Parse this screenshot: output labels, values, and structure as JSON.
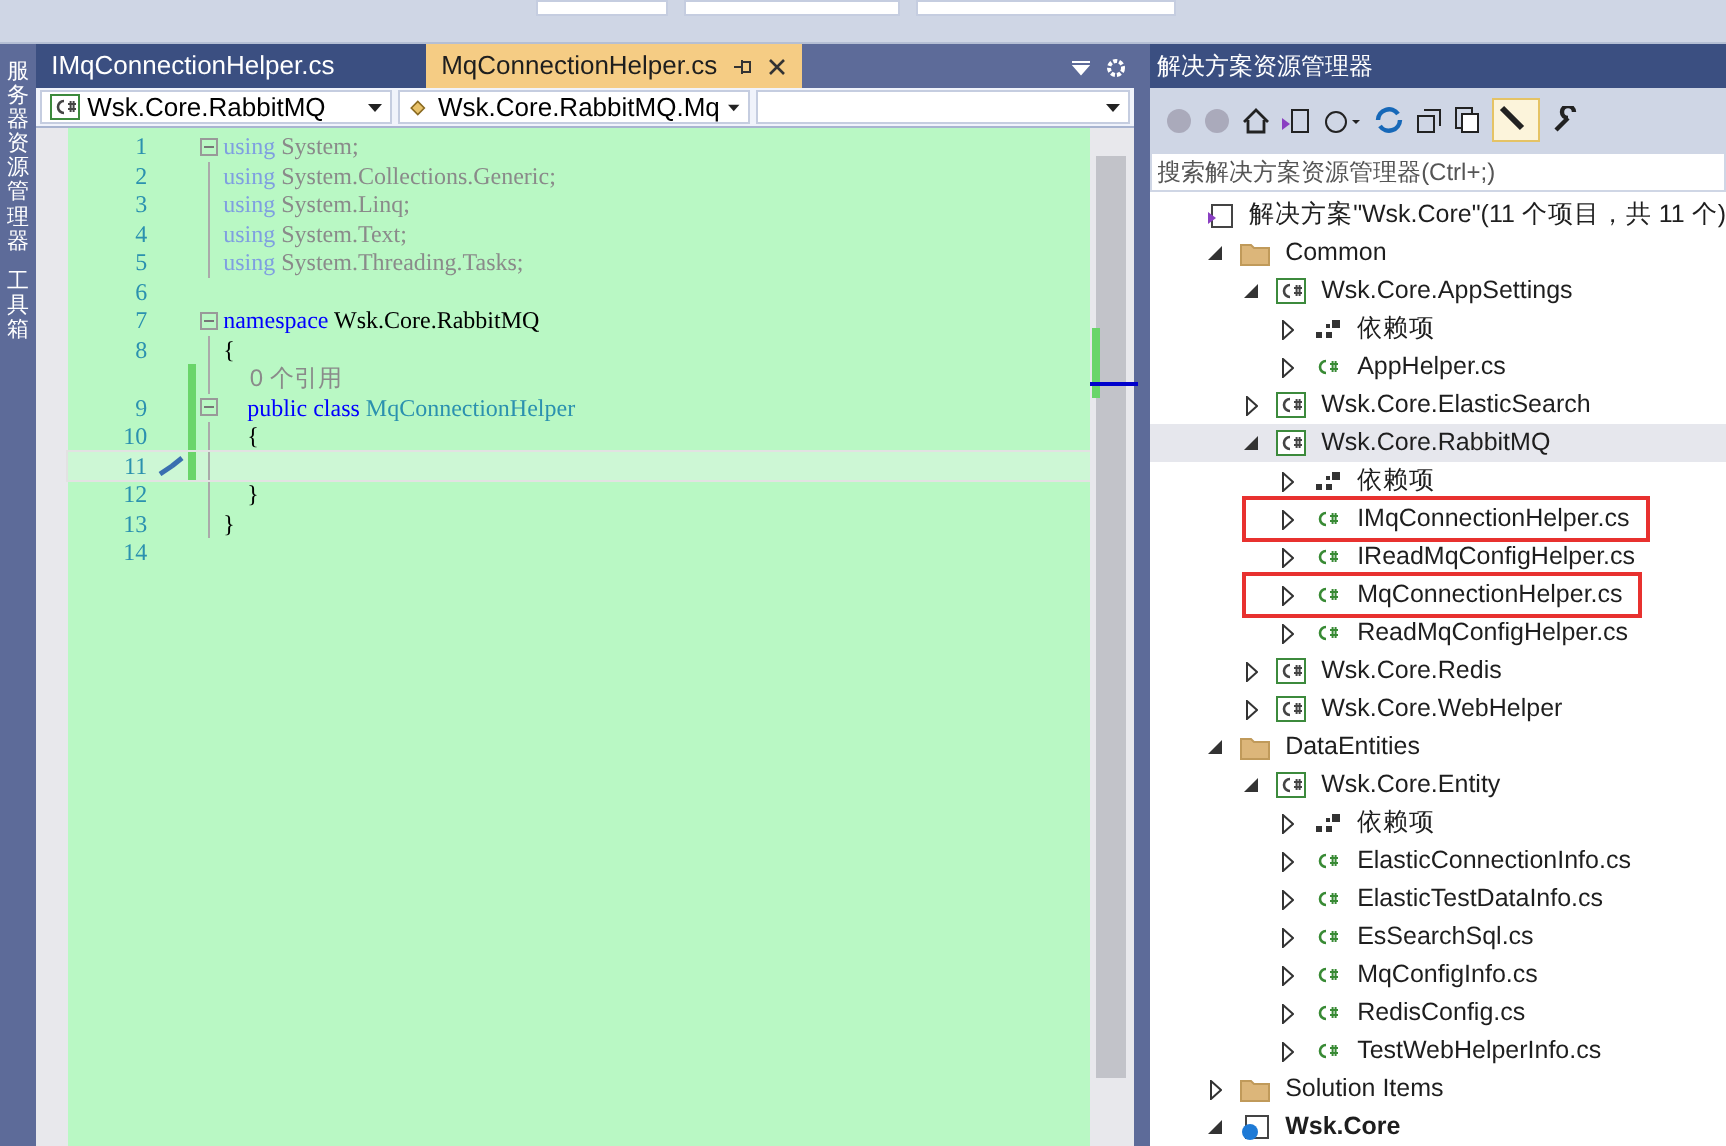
{
  "side_tabs": [
    "服务器资源管理器",
    "工具箱"
  ],
  "editor_tabs": [
    {
      "label": "IMqConnectionHelper.cs",
      "selected": false
    },
    {
      "label": "MqConnectionHelper.cs",
      "selected": true
    }
  ],
  "nav_bar": {
    "project": "Wsk.Core.RabbitMQ",
    "type": "Wsk.Core.RabbitMQ.Mq"
  },
  "code_lines": [
    {
      "number": "1",
      "kind": "fold",
      "changed": false,
      "current": false,
      "segments": [
        {
          "text": "using",
          "kind": "dimkeyword"
        },
        {
          "text": " System;",
          "kind": "dim"
        }
      ]
    },
    {
      "number": "2",
      "kind": "body",
      "changed": false,
      "current": false,
      "segments": [
        {
          "text": "using",
          "kind": "dimkeyword"
        },
        {
          "text": " System.Collections.Generic;",
          "kind": "dim"
        }
      ]
    },
    {
      "number": "3",
      "kind": "body",
      "changed": false,
      "current": false,
      "segments": [
        {
          "text": "using",
          "kind": "dimkeyword"
        },
        {
          "text": " System.Linq;",
          "kind": "dim"
        }
      ]
    },
    {
      "number": "4",
      "kind": "body",
      "changed": false,
      "current": false,
      "segments": [
        {
          "text": "using",
          "kind": "dimkeyword"
        },
        {
          "text": " System.Text;",
          "kind": "dim"
        }
      ]
    },
    {
      "number": "5",
      "kind": "body",
      "changed": false,
      "current": false,
      "segments": [
        {
          "text": "using",
          "kind": "dimkeyword"
        },
        {
          "text": " System.Threading.Tasks;",
          "kind": "dim"
        }
      ]
    },
    {
      "number": "6",
      "kind": "blank",
      "changed": false,
      "current": false
    },
    {
      "number": "7",
      "kind": "fold",
      "changed": false,
      "current": false,
      "segments": [
        {
          "text": "namespace",
          "kind": "keyword"
        },
        {
          "text": " Wsk.Core.RabbitMQ",
          "kind": "plain"
        }
      ]
    },
    {
      "number": "8",
      "kind": "body",
      "changed": false,
      "current": false,
      "segments": [
        {
          "text": "{",
          "kind": "plain"
        }
      ]
    },
    {
      "kind": "body",
      "changed": true,
      "current": false,
      "segments": [
        {
          "text": "    0 个引用",
          "kind": "lens"
        }
      ]
    },
    {
      "number": "9",
      "kind": "fold",
      "changed": true,
      "current": false,
      "segments": [
        {
          "text": "    public class",
          "kind": "keyword"
        },
        {
          "text": " MqConnectionHelper",
          "kind": "type"
        }
      ]
    },
    {
      "number": "10",
      "kind": "body",
      "changed": true,
      "current": false,
      "segments": [
        {
          "text": "    {",
          "kind": "plain"
        }
      ]
    },
    {
      "number": "11",
      "kind": "body",
      "changed": true,
      "current": true
    },
    {
      "number": "12",
      "kind": "body",
      "changed": false,
      "current": false,
      "segments": [
        {
          "text": "    }",
          "kind": "plain"
        }
      ]
    },
    {
      "number": "13",
      "kind": "body",
      "changed": false,
      "current": false,
      "segments": [
        {
          "text": "}",
          "kind": "plain"
        }
      ]
    },
    {
      "number": "14",
      "kind": "blank",
      "changed": false,
      "current": false
    }
  ],
  "solution_explorer": {
    "title": "解决方案资源管理器",
    "search": {
      "placeholder": "搜索解决方案资源管理器(Ctrl+;)"
    },
    "tree": [
      {
        "label": "解决方案\"Wsk.Core\"(11 个项目，共 11 个)",
        "kind": "solution",
        "children": [
          {
            "label": "Common",
            "kind": "folder",
            "expanded": true,
            "children": [
              {
                "label": "Wsk.Core.AppSettings",
                "kind": "project",
                "expanded": true,
                "children": [
                  {
                    "label": "依赖项",
                    "kind": "deps",
                    "expanded": false
                  },
                  {
                    "label": "AppHelper.cs",
                    "kind": "file",
                    "expanded": false
                  }
                ]
              },
              {
                "label": "Wsk.Core.ElasticSearch",
                "kind": "project",
                "expanded": false
              },
              {
                "label": "Wsk.Core.RabbitMQ",
                "kind": "project",
                "expanded": true,
                "selected": true,
                "children": [
                  {
                    "label": "依赖项",
                    "kind": "deps",
                    "expanded": false
                  },
                  {
                    "label": "IMqConnectionHelper.cs",
                    "kind": "file",
                    "expanded": false,
                    "highlighted": true
                  },
                  {
                    "label": "IReadMqConfigHelper.cs",
                    "kind": "file",
                    "expanded": false
                  },
                  {
                    "label": "MqConnectionHelper.cs",
                    "kind": "file",
                    "expanded": false,
                    "highlighted": true
                  },
                  {
                    "label": "ReadMqConfigHelper.cs",
                    "kind": "file",
                    "expanded": false
                  }
                ]
              },
              {
                "label": "Wsk.Core.Redis",
                "kind": "project",
                "expanded": false
              },
              {
                "label": "Wsk.Core.WebHelper",
                "kind": "project",
                "expanded": false
              }
            ]
          },
          {
            "label": "DataEntities",
            "kind": "folder",
            "expanded": true,
            "children": [
              {
                "label": "Wsk.Core.Entity",
                "kind": "project",
                "expanded": true,
                "children": [
                  {
                    "label": "依赖项",
                    "kind": "deps",
                    "expanded": false
                  },
                  {
                    "label": "ElasticConnectionInfo.cs",
                    "kind": "file",
                    "expanded": false
                  },
                  {
                    "label": "ElasticTestDataInfo.cs",
                    "kind": "file",
                    "expanded": false
                  },
                  {
                    "label": "EsSearchSql.cs",
                    "kind": "file",
                    "expanded": false
                  },
                  {
                    "label": "MqConfigInfo.cs",
                    "kind": "file",
                    "expanded": false
                  },
                  {
                    "label": "RedisConfig.cs",
                    "kind": "file",
                    "expanded": false
                  },
                  {
                    "label": "TestWebHelperInfo.cs",
                    "kind": "file",
                    "expanded": false
                  }
                ]
              }
            ]
          },
          {
            "label": "Solution Items",
            "kind": "folder",
            "expanded": false
          },
          {
            "label": "Wsk.Core",
            "kind": "webproject",
            "expanded": true,
            "startup": true
          }
        ]
      }
    ]
  }
}
